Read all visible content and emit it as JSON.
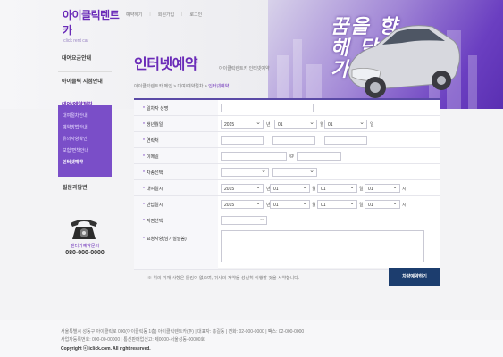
{
  "header": {
    "logo_main": "아이클릭렌트카",
    "logo_sub": "iclick rent car",
    "nav": [
      "예약하기",
      "회원가입",
      "로그인"
    ],
    "slogan": "꿈을 향해 달려가"
  },
  "sidebar": {
    "items": [
      {
        "label": "대여요금안내"
      },
      {
        "label": "아이클릭 지점안내"
      },
      {
        "label": "대여/예약절차"
      }
    ],
    "submenu": [
      "대여절차안내",
      "예약방법안내",
      "유의사항확인",
      "보험/면책안내",
      "인터넷예약"
    ],
    "faq": "질문과답변",
    "phone_caption": "렌터카예약문의",
    "phone_number": "080-000-0000"
  },
  "main": {
    "title": "인터넷예약",
    "subtitle": "아이클릭렌트카 인터넷예약",
    "breadcrumb": [
      "아이클릭렌트카 메인",
      "대여/예약절차",
      "인터넷예약"
    ],
    "form": {
      "rows": [
        {
          "label": "일차자 성명"
        },
        {
          "label": "생년월일",
          "year": "2015",
          "month": "01",
          "day": "01",
          "u_year": "년",
          "u_month": "월",
          "u_day": "일"
        },
        {
          "label": "연락처"
        },
        {
          "label": "이메일",
          "at": "@"
        },
        {
          "label": "차종선택"
        },
        {
          "label": "대여일시",
          "year": "2015",
          "month": "01",
          "day": "01",
          "hour": "01",
          "u_year": "년",
          "u_month": "월",
          "u_day": "일",
          "u_hour": "시"
        },
        {
          "label": "반납일시",
          "year": "2015",
          "month": "01",
          "day": "01",
          "hour": "01",
          "u_year": "년",
          "u_month": "월",
          "u_day": "일",
          "u_hour": "시"
        },
        {
          "label": "지점선택"
        },
        {
          "label": "요청사항(남기실말씀)"
        }
      ]
    },
    "note": "※ 위의 기재 사항은 틀림이 없으며, 귀사의 계약을 성실히 이행할 것을 서약합니다.",
    "submit_label": "차량예약하기"
  },
  "footer": {
    "line1": "서울특별시 성동구 아이클릭로 000(아이클릭동 1층) 아이클릭렌트카(주) | 대표자: 홍길동 | 전화: 02-000-0000 | 팩스: 02-000-0000",
    "line2": "사업자등록번호: 000-00-00000 | 통신판매업신고: 제0000-서울성동-00000호",
    "line3": "Copyright ⓒ iclick.com. All right reserved."
  },
  "colors": {
    "accent": "#6a2bb8",
    "button": "#1c3d6e"
  }
}
